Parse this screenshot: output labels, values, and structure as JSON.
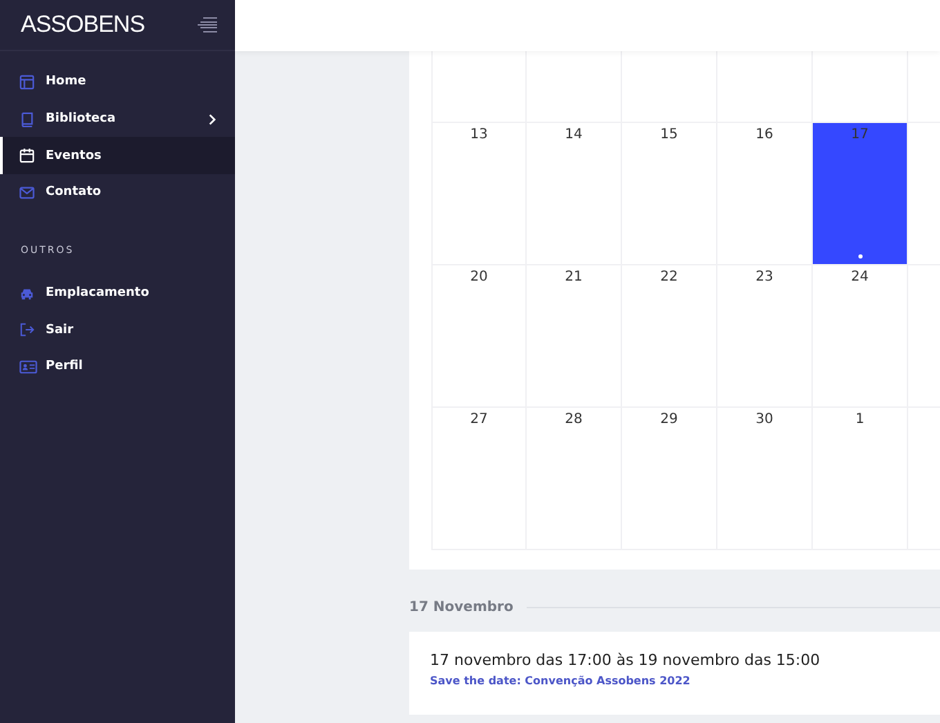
{
  "sidebar": {
    "logo": "ASSOBENS",
    "items": [
      {
        "label": "Home",
        "selected": false,
        "has_submenu": false
      },
      {
        "label": "Biblioteca",
        "selected": false,
        "has_submenu": true
      },
      {
        "label": "Eventos",
        "selected": true,
        "has_submenu": false
      },
      {
        "label": "Contato",
        "selected": false,
        "has_submenu": false
      }
    ],
    "section_title": "OUTROS",
    "section_items": [
      {
        "label": "Emplacamento",
        "selected": false,
        "has_submenu": false
      },
      {
        "label": "Sair",
        "selected": false,
        "has_submenu": false
      },
      {
        "label": "Perfil",
        "selected": false,
        "has_submenu": false
      }
    ]
  },
  "calendar": {
    "weeks": [
      [
        {
          "day": "13",
          "selected": false,
          "has_event": false
        },
        {
          "day": "14",
          "selected": false,
          "has_event": false
        },
        {
          "day": "15",
          "selected": false,
          "has_event": false
        },
        {
          "day": "16",
          "selected": false,
          "has_event": false
        },
        {
          "day": "17",
          "selected": true,
          "has_event": true
        }
      ],
      [
        {
          "day": "20",
          "selected": false,
          "has_event": false
        },
        {
          "day": "21",
          "selected": false,
          "has_event": false
        },
        {
          "day": "22",
          "selected": false,
          "has_event": false
        },
        {
          "day": "23",
          "selected": false,
          "has_event": false
        },
        {
          "day": "24",
          "selected": false,
          "has_event": false
        }
      ],
      [
        {
          "day": "27",
          "selected": false,
          "has_event": false
        },
        {
          "day": "28",
          "selected": false,
          "has_event": false
        },
        {
          "day": "29",
          "selected": false,
          "has_event": false
        },
        {
          "day": "30",
          "selected": false,
          "has_event": false
        },
        {
          "day": "1",
          "selected": false,
          "has_event": false
        }
      ]
    ]
  },
  "events": {
    "date_heading": "17 Novembro",
    "items": [
      {
        "time": "17 novembro das 17:00 às 19 novembro das 15:00",
        "title": "Save the date: Convenção Assobens 2022"
      }
    ]
  }
}
